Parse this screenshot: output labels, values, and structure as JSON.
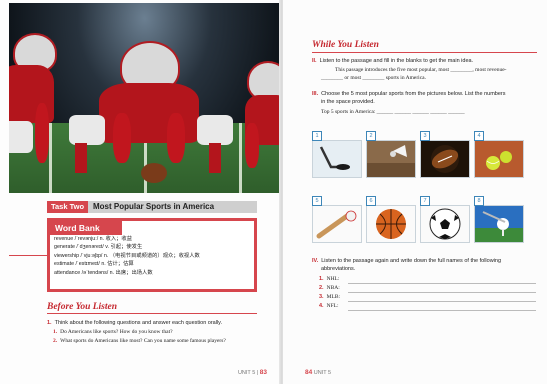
{
  "left_page": {
    "task": {
      "tag": "Task Two",
      "title": "Most Popular Sports in America"
    },
    "word_bank": {
      "title": "Word Bank",
      "entries": [
        "revenue /ˈrevənjuː/ n. 收入；收益",
        "generate /ˈdʒenəreɪt/ v. 引起；使发生",
        "viewership /ˈvjuːəʃɪp/ n. （电视节目或频道的）观众；收视人数",
        "estimate /ˈestɪmeɪt/ n. 估计；估算",
        "attendance /əˈtendəns/ n. 出席；出场人数"
      ]
    },
    "before_you_listen": {
      "title": "Before You Listen",
      "instruction_num": "1.",
      "instruction": "Think about the following questions and answer each question orally.",
      "questions": [
        {
          "num": "1.",
          "text": "Do Americans like sports? How do you know that?"
        },
        {
          "num": "2.",
          "text": "What sports do Americans like most? Can you name some famous players?"
        }
      ]
    },
    "folio": {
      "unit": "UNIT 5",
      "page": "83"
    }
  },
  "right_page": {
    "section_title": "While You Listen",
    "part2": {
      "numeral": "II.",
      "instruction": "Listen to the passage and fill in the blanks to get the main idea.",
      "line1": "This passage introduces the five most popular, most ________, most revenue-",
      "line2": "________ or most ________ sports in America."
    },
    "part3": {
      "numeral": "III.",
      "instruction_a": "Choose the 5 most popular sports from the pictures below. List the numbers",
      "instruction_b": "in the space provided.",
      "answer_line": "Top 5 sports in America: ______  ______  ______  ______  ______",
      "pictures": [
        {
          "num": "1",
          "icon": "hockey-puck-icon"
        },
        {
          "num": "2",
          "icon": "shuttlecock-icon"
        },
        {
          "num": "3",
          "icon": "american-football-icon"
        },
        {
          "num": "4",
          "icon": "tennis-ball-icon"
        },
        {
          "num": "5",
          "icon": "baseball-bat-icon"
        },
        {
          "num": "6",
          "icon": "basketball-icon"
        },
        {
          "num": "7",
          "icon": "soccer-ball-icon"
        },
        {
          "num": "8",
          "icon": "golf-ball-icon"
        }
      ]
    },
    "part4": {
      "numeral": "IV.",
      "instruction_a": "Listen to the passage again and write down the full names of the following",
      "instruction_b": "abbreviations.",
      "items": [
        {
          "num": "1.",
          "label": "NHL:"
        },
        {
          "num": "2.",
          "label": "NBA:"
        },
        {
          "num": "3.",
          "label": "MLB:"
        },
        {
          "num": "4.",
          "label": "NFL:"
        }
      ]
    },
    "folio": {
      "page": "84",
      "unit": "UNIT 5"
    }
  },
  "colors": {
    "accent": "#d6464d",
    "title_red": "#c5282f",
    "number_blue": "#3d86b8",
    "jersey": "#b3151c"
  }
}
